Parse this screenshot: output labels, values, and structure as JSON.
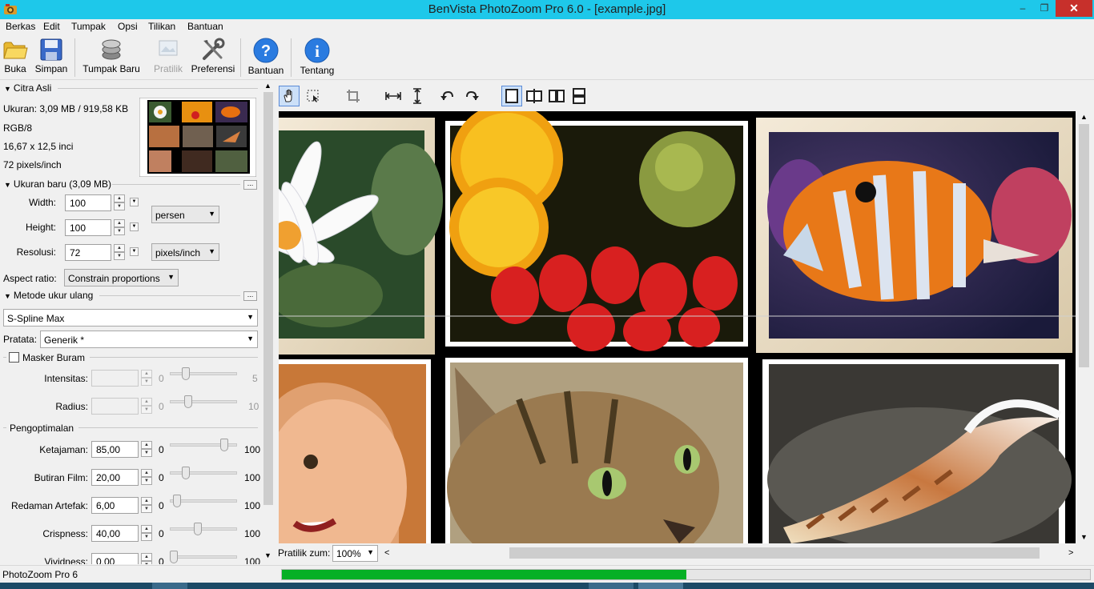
{
  "window": {
    "title": "BenVista PhotoZoom Pro 6.0 - [example.jpg]",
    "minimize": "–",
    "maximize": "❐",
    "close": "✕"
  },
  "menu": [
    "Berkas",
    "Edit",
    "Tumpak",
    "Opsi",
    "Tilikan",
    "Bantuan"
  ],
  "toolbar": {
    "buka": "Buka",
    "simpan": "Simpan",
    "tumpak_baru": "Tumpak Baru",
    "pratilik": "Pratilik",
    "preferensi": "Preferensi",
    "bantuan": "Bantuan",
    "tentang": "Tentang"
  },
  "citra_asli": {
    "heading": "Citra Asli",
    "ukuran": "Ukuran: 3,09 MB / 919,58 KB",
    "mode": "RGB/8",
    "dimensi": "16,67 x 12,5 inci",
    "resolusi": "72 pixels/inch"
  },
  "ukuran_baru": {
    "heading": "Ukuran baru (3,09 MB)",
    "width_label": "Width:",
    "width_value": "100",
    "height_label": "Height:",
    "height_value": "100",
    "unit": "persen",
    "resolusi_label": "Resolusi:",
    "resolusi_value": "72",
    "resolusi_unit": "pixels/inch",
    "aspect_label": "Aspect ratio:",
    "aspect_value": "Constrain proportions",
    "more": "..."
  },
  "metode": {
    "heading": "Metode ukur ulang",
    "method": "S-Spline Max",
    "pratata_label": "Pratata:",
    "pratata_value": "Generik *",
    "more": "..."
  },
  "masker": {
    "label": "Masker Buram",
    "intensitas_label": "Intensitas:",
    "intensitas_min": "0",
    "intensitas_max": "5",
    "radius_label": "Radius:",
    "radius_min": "0",
    "radius_max": "10"
  },
  "optimasi": {
    "heading": "Pengoptimalan",
    "rows": [
      {
        "label": "Ketajaman:",
        "value": "85,00",
        "min": "0",
        "max": "100",
        "level": 0.85
      },
      {
        "label": "Butiran Film:",
        "value": "20,00",
        "min": "0",
        "max": "100",
        "level": 0.2
      },
      {
        "label": "Redaman Artefak:",
        "value": "6,00",
        "min": "0",
        "max": "100",
        "level": 0.06
      },
      {
        "label": "Crispness:",
        "value": "40,00",
        "min": "0",
        "max": "100",
        "level": 0.4
      },
      {
        "label": "Vividness:",
        "value": "0,00",
        "min": "0",
        "max": "100",
        "level": 0.0
      }
    ]
  },
  "viewer": {
    "zoom_label": "Pratilik zum:",
    "zoom_value": "100%"
  },
  "status": {
    "text": "PhotoZoom Pro 6",
    "progress": 0.5
  },
  "colors": {
    "titlebar": "#1ec8ea",
    "close": "#c7302b",
    "progress": "#06b025",
    "accent": "#2a7be0"
  }
}
